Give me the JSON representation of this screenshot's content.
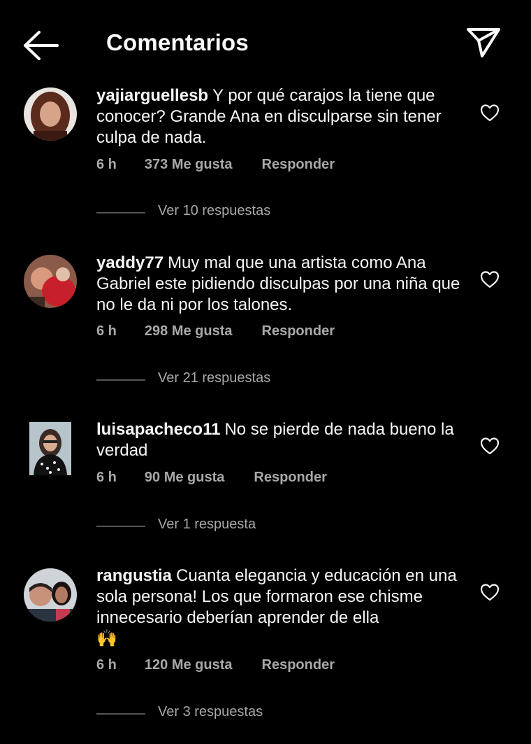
{
  "header": {
    "title": "Comentarios",
    "back_icon": "arrow-left-icon",
    "send_icon": "paper-plane-icon"
  },
  "comments": [
    {
      "username": "yajiarguellesb",
      "text": "Y por qué carajos la tiene que conocer? Grande Ana en disculparse sin tener culpa de nada.",
      "time": "6 h",
      "likes": "373 Me gusta",
      "reply": "Responder",
      "view_replies": "Ver 10 respuestas"
    },
    {
      "username": "yaddy77",
      "text": "Muy mal que una artista como Ana Gabriel este pidiendo disculpas por una niña que no le da ni por los talones.",
      "time": "6 h",
      "likes": "298 Me gusta",
      "reply": "Responder",
      "view_replies": "Ver 21 respuestas"
    },
    {
      "username": "luisapacheco11",
      "text": "No se pierde de nada bueno la verdad",
      "time": "6 h",
      "likes": "90 Me gusta",
      "reply": "Responder",
      "view_replies": "Ver 1 respuesta"
    },
    {
      "username": "rangustia",
      "text": "Cuanta elegancia y educación en una sola persona! Los que formaron ese chisme innecesario deberían aprender de ella",
      "emoji": "🙌",
      "time": "6 h",
      "likes": "120 Me gusta",
      "reply": "Responder",
      "view_replies": "Ver 3 respuestas"
    }
  ],
  "colors": {
    "background": "#000000",
    "text": "#f5f5f5",
    "secondary": "#a8a8a8",
    "divider": "#555555"
  }
}
